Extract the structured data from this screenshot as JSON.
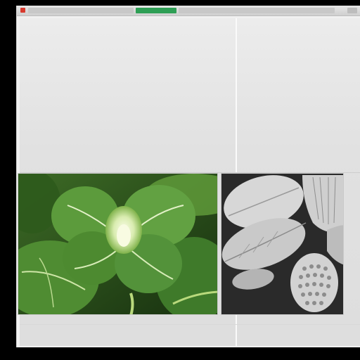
{
  "window": {
    "tabs_count_hint": "",
    "active_tab": "tab-green"
  },
  "colors": {
    "background": "#000000",
    "window_bg": "#f1f1f1",
    "accent_tab": "#2e9f55",
    "close_button": "#d83a2e"
  },
  "tiles": [
    {
      "name": "plant-photo-thumbnail",
      "subject": "green-leaf-flower"
    },
    {
      "name": "monochrome-leaves-thumbnail",
      "subject": "grayscale-leaves-and-seed"
    }
  ]
}
